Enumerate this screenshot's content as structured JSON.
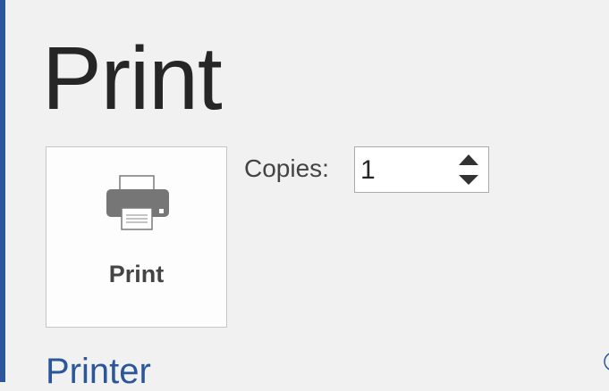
{
  "page": {
    "title": "Print"
  },
  "print_button": {
    "label": "Print",
    "icon": "printer-icon"
  },
  "copies": {
    "label": "Copies:",
    "value": "1"
  },
  "printer_section": {
    "heading": "Printer"
  },
  "colors": {
    "accent": "#2b579a",
    "background": "#f1f1f1",
    "text": "#444444"
  }
}
